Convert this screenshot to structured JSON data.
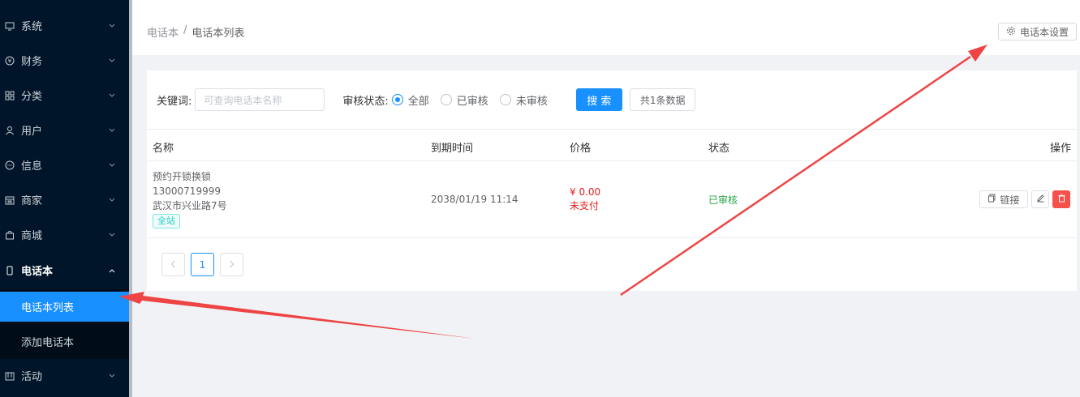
{
  "sidebar": {
    "items": [
      {
        "label": "系统",
        "icon": "monitor-icon"
      },
      {
        "label": "财务",
        "icon": "yen-icon"
      },
      {
        "label": "分类",
        "icon": "grid-icon"
      },
      {
        "label": "用户",
        "icon": "user-icon"
      },
      {
        "label": "信息",
        "icon": "chat-icon"
      },
      {
        "label": "商家",
        "icon": "store-icon"
      },
      {
        "label": "商城",
        "icon": "bag-icon"
      },
      {
        "label": "电话本",
        "icon": "phone-icon"
      },
      {
        "label": "活动",
        "icon": "calendar-icon"
      }
    ],
    "sub_items": [
      {
        "label": "电话本列表"
      },
      {
        "label": "添加电话本"
      }
    ],
    "active_color": "#1890ff"
  },
  "breadcrumb": {
    "parent": "电话本",
    "separator": "/",
    "current": "电话本列表"
  },
  "header": {
    "settings_label": "电话本设置"
  },
  "filter": {
    "keyword_label": "关键词:",
    "keyword_placeholder": "可查询电话本名称",
    "status_label": "审核状态:",
    "options": [
      "全部",
      "已审核",
      "未审核"
    ],
    "selected": "全部",
    "search_label": "搜 索",
    "count_label": "共1条数据"
  },
  "table": {
    "columns": [
      "名称",
      "到期时间",
      "价格",
      "状态",
      "操作"
    ],
    "rows": [
      {
        "name": "预约开锁换锁",
        "phone": "13000719999",
        "address": "武汉市兴业路7号",
        "tag": "全站",
        "expire": "2038/01/19 11:14",
        "price": "¥ 0.00",
        "pay_status": "未支付",
        "status": "已审核",
        "link_label": "链接"
      }
    ]
  },
  "pagination": {
    "current": "1"
  }
}
